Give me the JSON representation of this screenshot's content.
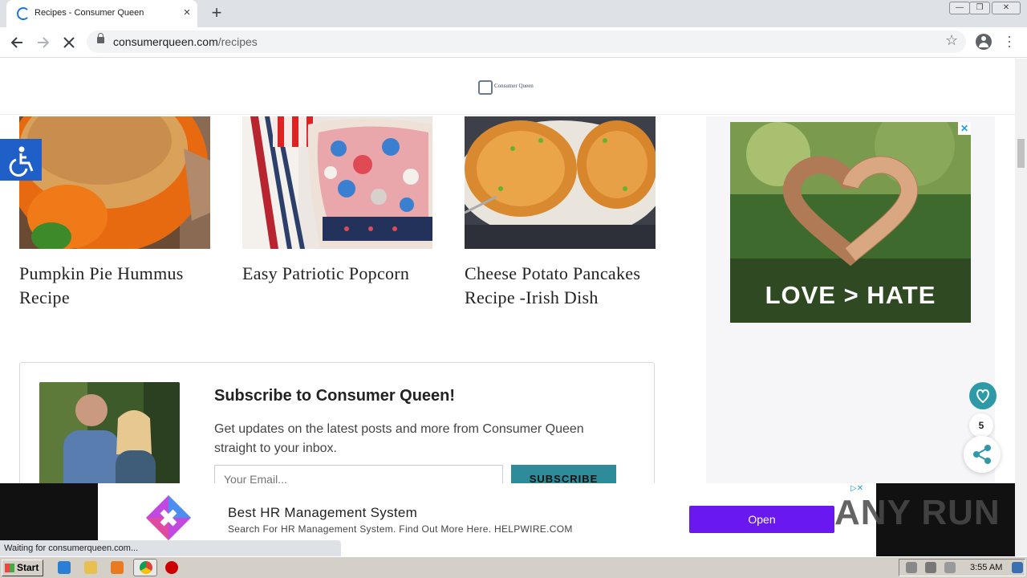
{
  "browser": {
    "tab_title": "Recipes - Consumer Queen",
    "tab_close": "×",
    "new_tab": "+",
    "url_host": "consumerqueen.com",
    "url_path": "/recipes",
    "window_buttons": [
      "—",
      "❐",
      "✕"
    ]
  },
  "site": {
    "logo_text": "Consumer Queen"
  },
  "recipes": [
    {
      "title": "Pumpkin Pie Hummus Recipe"
    },
    {
      "title": "Easy Patriotic Popcorn"
    },
    {
      "title": "Cheese Potato Pancakes Recipe -Irish Dish"
    }
  ],
  "subscribe": {
    "title": "Subscribe to Consumer Queen!",
    "description": "Get updates on the latest posts and more from Consumer Queen straight to your inbox.",
    "email_placeholder": "Your Email...",
    "button": "SUBSCRIBE"
  },
  "sidebar_ad": {
    "text": "LOVE > HATE",
    "close": "✕"
  },
  "floating": {
    "fav_count": "5"
  },
  "banner_ad": {
    "title": "Best HR Management System",
    "description": "Search For HR Management System. Find Out More Here. HELPWIRE.COM",
    "button": "Open",
    "watermark": "ANY RUN"
  },
  "status_text": "Waiting for consumerqueen.com...",
  "taskbar": {
    "start": "Start",
    "clock": "3:55 AM"
  },
  "colors": {
    "accent_teal": "#2e8b9a",
    "accessibility_blue": "#1f5fc8",
    "banner_purple": "#6a18f0"
  }
}
